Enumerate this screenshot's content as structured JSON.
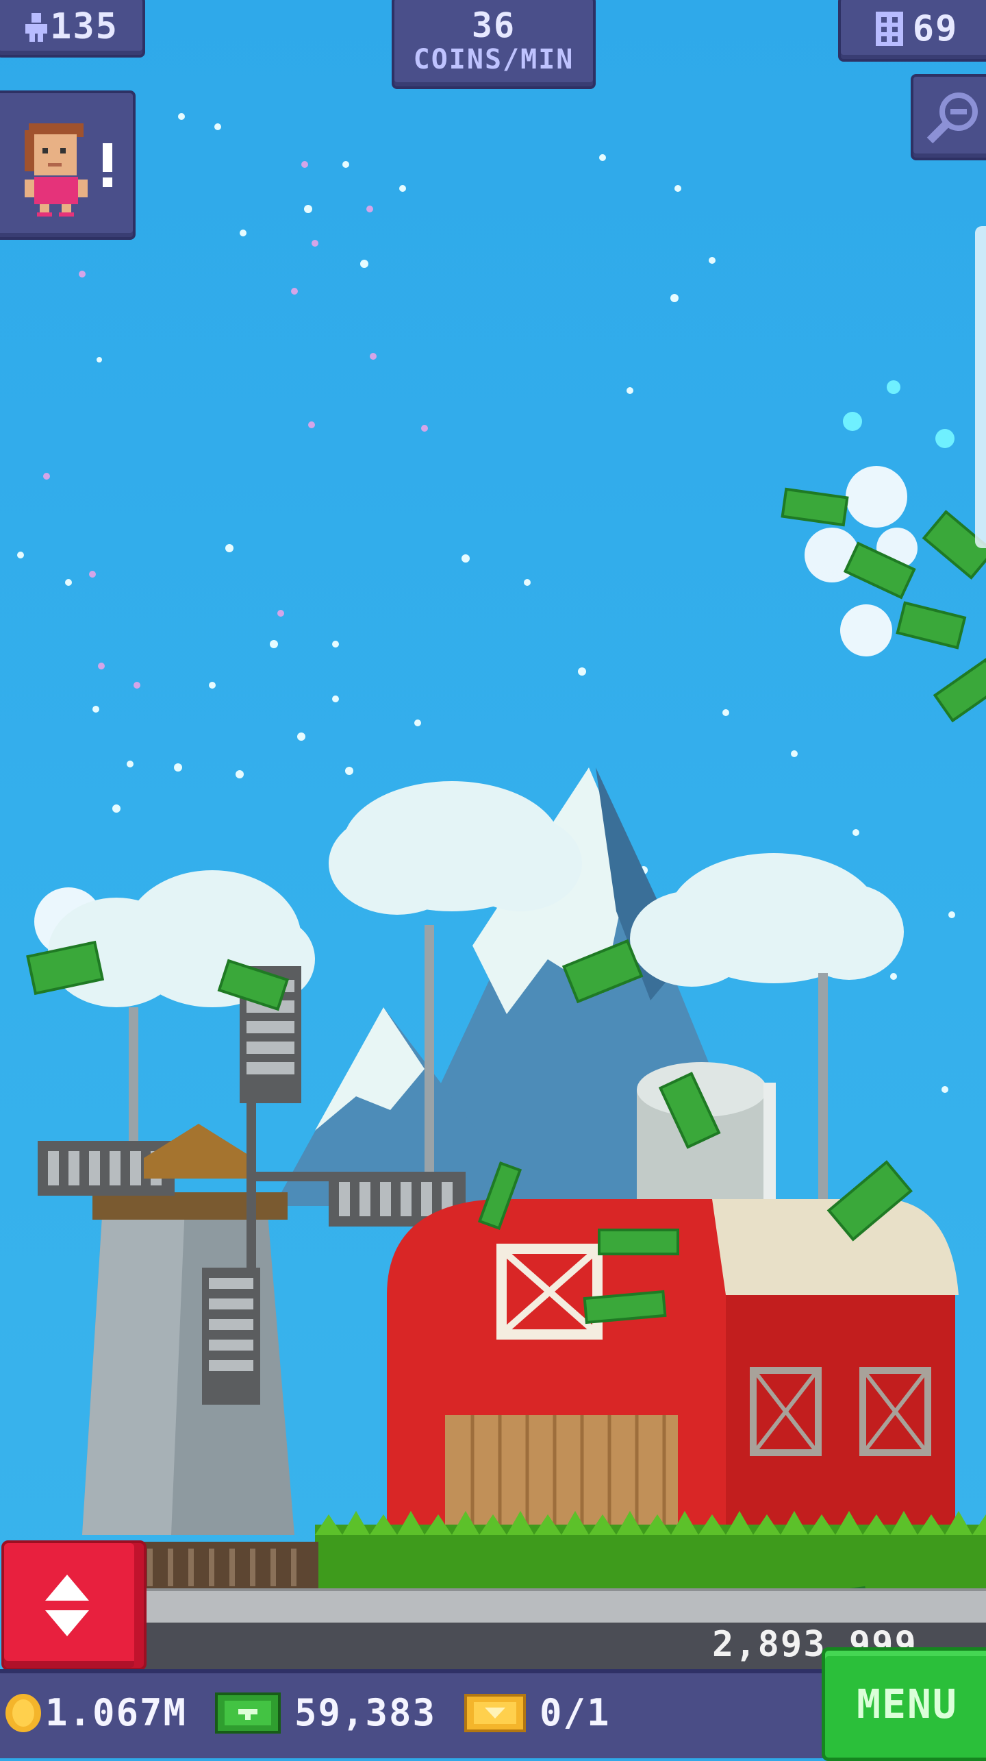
{
  "hud": {
    "population": "135",
    "coins_per_min_value": "36",
    "coins_per_min_label": "COINS/MIN",
    "floors": "69"
  },
  "icons": {
    "population": "person-icon",
    "floors": "building-icon",
    "zoom": "magnifier-minus-icon",
    "avatar": "bitizen-avatar-icon",
    "notification": "exclamation-icon",
    "elevator": "up-down-arrows-icon",
    "coin": "coin-icon",
    "bux": "tower-bux-icon",
    "vip": "golden-ticket-icon"
  },
  "scene": {
    "description_items": [
      "sky",
      "clouds",
      "mountain",
      "windmill",
      "red-barn",
      "silo",
      "grass",
      "flying-bux",
      "sparkles"
    ]
  },
  "tower": {
    "score_display": "2,893,999"
  },
  "bottom_bar": {
    "coins": "1.067M",
    "bux": "59,383",
    "vip": "0/1",
    "menu_label": "MENU"
  },
  "colors": {
    "sky": "#2fa9e8",
    "hud": "#4a4f8a",
    "barn": "#d82424",
    "menu": "#2bbf3a",
    "elevator": "#e8203e"
  }
}
